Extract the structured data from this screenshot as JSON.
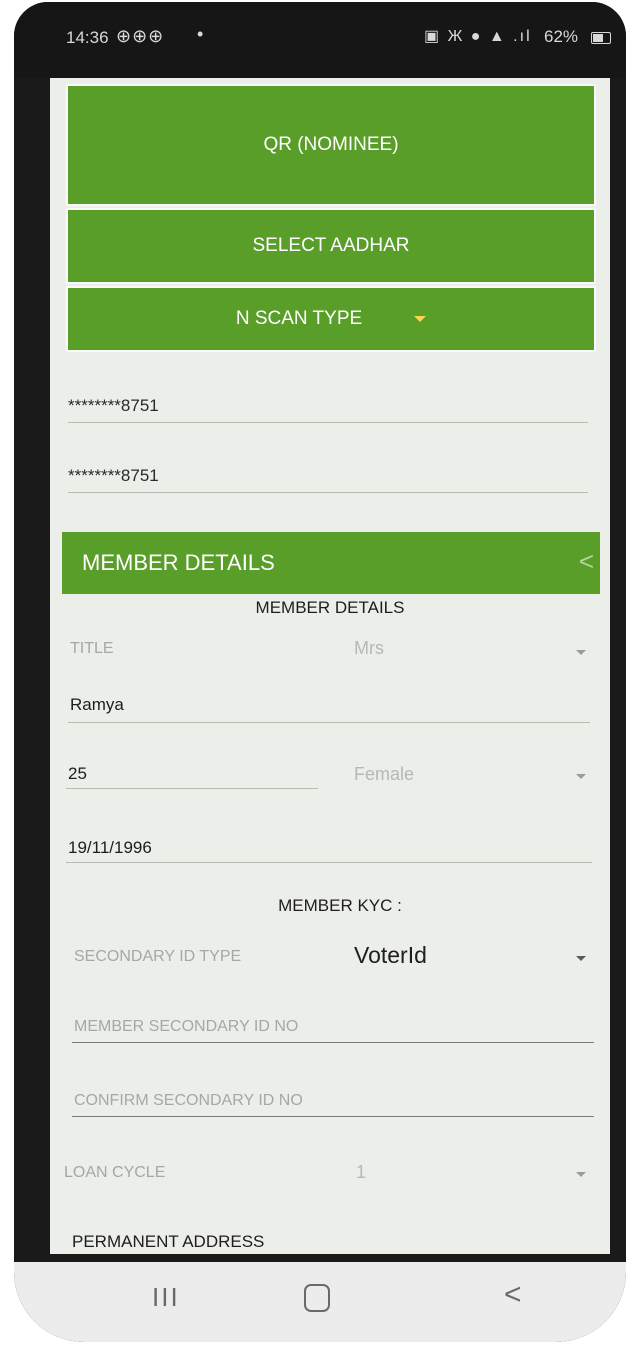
{
  "status_bar": {
    "time": "14:36",
    "notification_icons": "⊕⊕⊕",
    "dot": "•",
    "system_icons": "▣ Ж ● ▲ .ıl",
    "battery_percent": "62%",
    "battery_level": 0.62
  },
  "buttons": {
    "qr_nominee": "QR (NOMINEE)",
    "select_aadhar": "SELECT AADHAR",
    "n_scan_type": "N SCAN TYPE"
  },
  "aadhar_fields": {
    "aadhar_1": "********8751",
    "aadhar_2": "********8751"
  },
  "member_section": {
    "bar_title": "MEMBER DETAILS",
    "bar_chevron": "<",
    "heading": "MEMBER DETAILS",
    "title_label": "TITLE",
    "title_value": "Mrs",
    "name": "Ramya",
    "age": "25",
    "gender": "Female",
    "dob": "19/11/1996"
  },
  "kyc_section": {
    "heading": "MEMBER KYC :",
    "secondary_id_type_label": "SECONDARY ID TYPE",
    "secondary_id_type_value": "VoterId",
    "secondary_id_no_placeholder": "MEMBER SECONDARY ID NO",
    "confirm_id_no_placeholder": "CONFIRM SECONDARY ID NO",
    "loan_cycle_label": "LOAN CYCLE",
    "loan_cycle_value": "1",
    "permanent_address_label": "PERMANENT ADDRESS"
  },
  "nav_bar": {
    "recents": "III",
    "back": "<"
  },
  "colors": {
    "accent_green": "#5a9e2a",
    "caret_yellow": "#ffd34f"
  }
}
